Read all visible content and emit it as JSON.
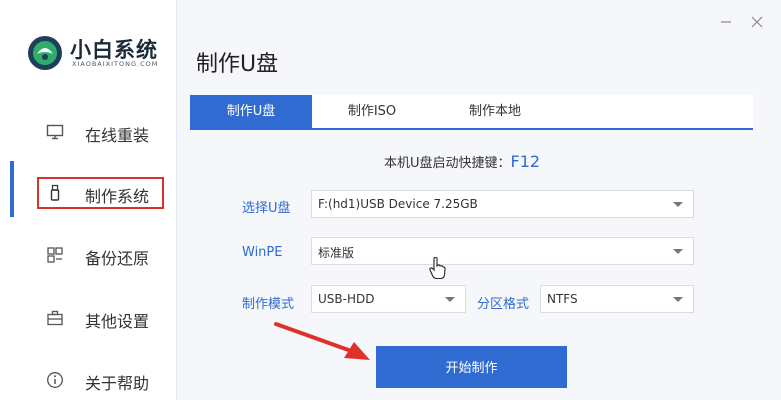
{
  "app": {
    "title": "小白系统",
    "subtitle": "XIAOBAIXITONG.COM"
  },
  "page": {
    "title": "制作U盘"
  },
  "sidebar": {
    "items": [
      {
        "label": "在线重装",
        "icon": "monitor-icon"
      },
      {
        "label": "制作系统",
        "icon": "usb-icon"
      },
      {
        "label": "备份还原",
        "icon": "backup-icon"
      },
      {
        "label": "其他设置",
        "icon": "briefcase-icon"
      },
      {
        "label": "关于帮助",
        "icon": "info-icon"
      }
    ],
    "active_index": 1
  },
  "tabs": [
    {
      "label": "制作U盘"
    },
    {
      "label": "制作ISO"
    },
    {
      "label": "制作本地"
    }
  ],
  "hint": {
    "text": "本机U盘启动快捷键：",
    "key": "F12"
  },
  "form": {
    "usb": {
      "label": "选择U盘",
      "value": "F:(hd1)USB Device 7.25GB"
    },
    "winpe": {
      "label": "WinPE",
      "value": "标准版"
    },
    "mode": {
      "label": "制作模式",
      "value": "USB-HDD"
    },
    "partition": {
      "label": "分区格式",
      "value": "NTFS"
    }
  },
  "actions": {
    "start": "开始制作"
  },
  "colors": {
    "accent": "#2f6bd1",
    "highlight": "#d9322a",
    "background": "#f5f7fa"
  }
}
